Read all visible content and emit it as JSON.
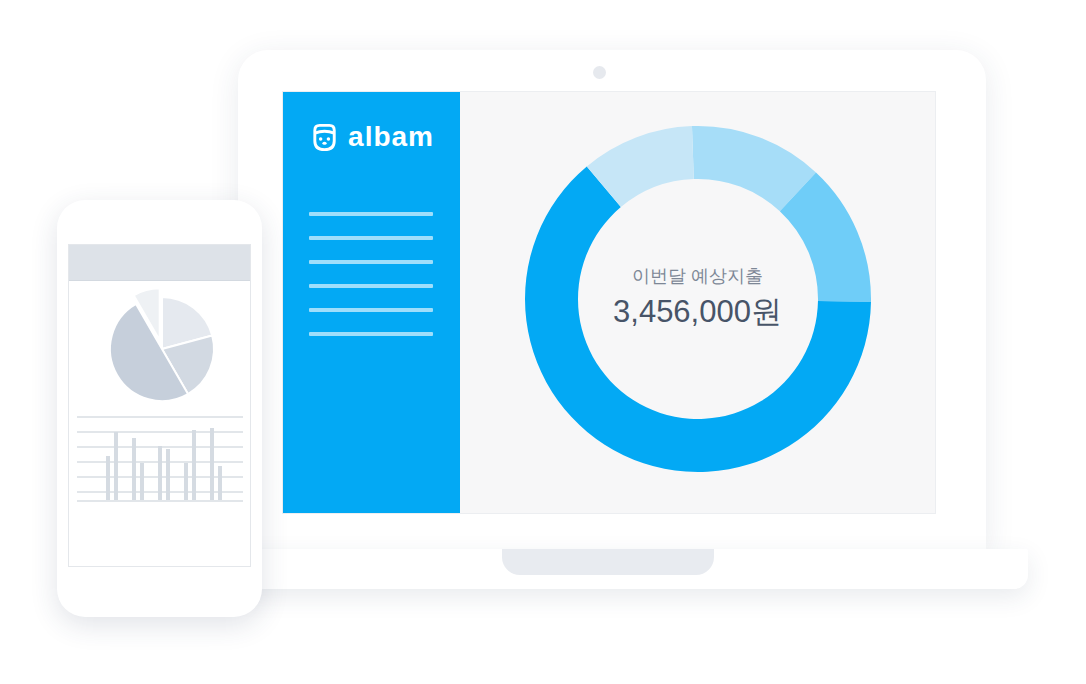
{
  "app": {
    "logo": "albam"
  },
  "summary": {
    "label": "이번달 예상지출",
    "amount": "3,456,000원"
  },
  "donut": {
    "segments": [
      {
        "value": 45,
        "color": "#a6ddf8"
      },
      {
        "value": 48,
        "color": "#6fcdf8"
      },
      {
        "value": 229,
        "color": "#03a9f4"
      },
      {
        "value": 38,
        "color": "#c6e6f7"
      }
    ]
  },
  "phone": {
    "pie": {
      "segments": [
        {
          "value": 75,
          "color": "#e5e9ef",
          "exploded": false
        },
        {
          "value": 75,
          "color": "#d2d9e2",
          "exploded": false
        },
        {
          "value": 180,
          "color": "#c6cfdb",
          "exploded": false
        },
        {
          "value": 30,
          "color": "#eef1f4",
          "exploded": true
        }
      ]
    },
    "bars": {
      "values": [
        42,
        65,
        59,
        35,
        51,
        49,
        35,
        67,
        69,
        32
      ]
    }
  }
}
